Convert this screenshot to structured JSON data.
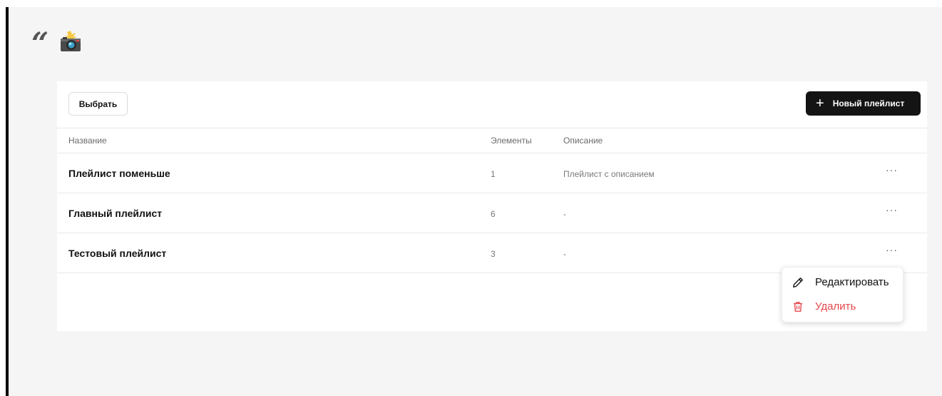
{
  "header": {
    "quote_mark": "“",
    "camera_icon": "camera-with-flash-emoji"
  },
  "toolbar": {
    "select_label": "Выбрать",
    "new_playlist_label": "Новый плейлист",
    "new_playlist_icon": "plus-icon"
  },
  "table": {
    "columns": [
      "Название",
      "Элементы",
      "Описание"
    ],
    "rows": [
      {
        "name": "Плейлист поменьше",
        "count": "1",
        "description": "Плейлист с описанием",
        "more": "···"
      },
      {
        "name": "Главный плейлист",
        "count": "6",
        "description": "-",
        "more": "···"
      },
      {
        "name": "Тестовый плейлист",
        "count": "3",
        "description": "-",
        "more": "···"
      }
    ]
  },
  "context_menu": {
    "edit_label": "Редактировать",
    "edit_icon": "pencil-icon",
    "delete_label": "Удалить",
    "delete_icon": "trash-icon",
    "delete_color": "#e5484d"
  },
  "colors": {
    "background": "#f5f5f5",
    "primary_button": "#141414"
  }
}
